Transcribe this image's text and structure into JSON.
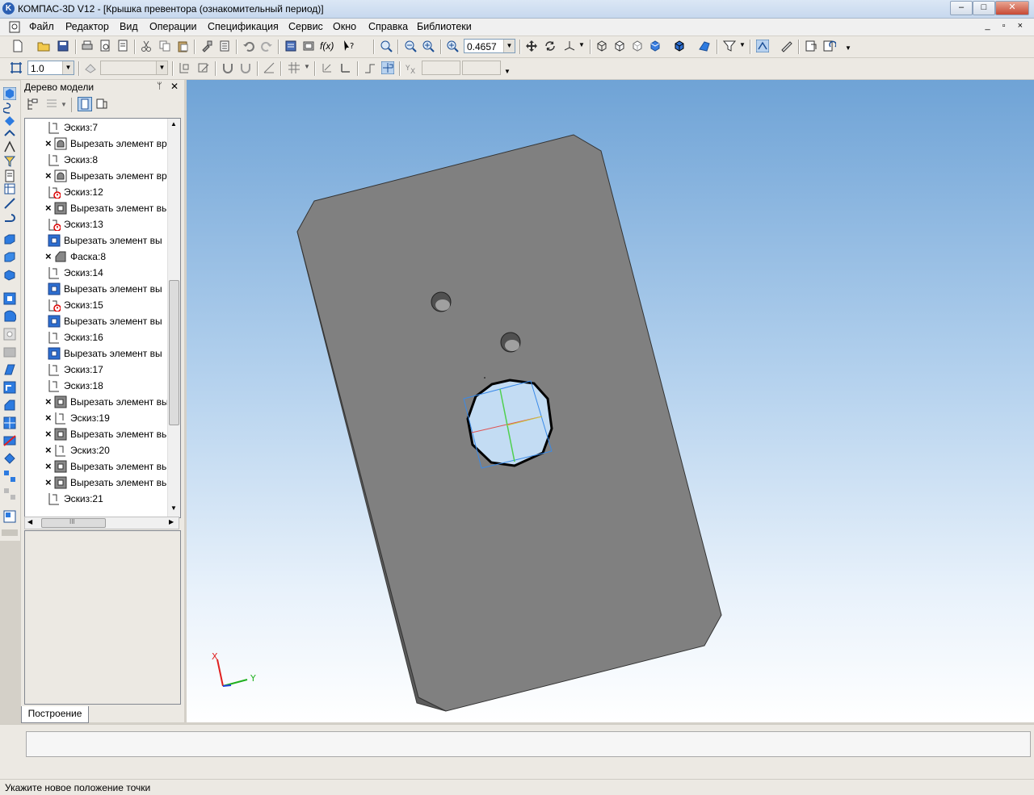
{
  "window": {
    "title": "КОМПАС-3D V12 - [Крышка превентора (ознакомительный период)]",
    "logo_letter": "K",
    "buttons": [
      "–",
      "□",
      "✕"
    ]
  },
  "menu": [
    {
      "label": "Файл"
    },
    {
      "label": "Редактор"
    },
    {
      "label": "Вид"
    },
    {
      "label": "Операции"
    },
    {
      "label": "Спецификация"
    },
    {
      "label": "Сервис"
    },
    {
      "label": "Окно"
    },
    {
      "label": "Справка"
    },
    {
      "label": "Библиотеки"
    }
  ],
  "mdi_buttons": "_ ▫ ×",
  "toolbar_main": {
    "fx_label": "f(x)",
    "zoom_value": "0.4657"
  },
  "toolbar_second": {
    "scale_value": "1.0"
  },
  "tree": {
    "title": "Дерево модели",
    "pin_glyph": "ᛘ",
    "close_glyph": "✕",
    "rows": [
      {
        "label": "Эскиз:7",
        "icon": "sketch-icon",
        "x": false,
        "err": false
      },
      {
        "label": "Вырезать элемент вр",
        "icon": "cut-rotate-icon",
        "x": true,
        "err": false
      },
      {
        "label": "Эскиз:8",
        "icon": "sketch-icon",
        "x": false,
        "err": false
      },
      {
        "label": "Вырезать элемент вр",
        "icon": "cut-rotate-icon",
        "x": true,
        "err": false
      },
      {
        "label": "Эскиз:12",
        "icon": "sketch-icon",
        "x": false,
        "err": true
      },
      {
        "label": "Вырезать элемент вь",
        "icon": "cut-extrude-icon",
        "x": true,
        "err": false
      },
      {
        "label": "Эскиз:13",
        "icon": "sketch-icon",
        "x": false,
        "err": true
      },
      {
        "label": "Вырезать элемент вы",
        "icon": "cut-extrude-blue-icon",
        "x": false,
        "err": false
      },
      {
        "label": "Фаска:8",
        "icon": "chamfer-icon",
        "x": true,
        "err": false
      },
      {
        "label": "Эскиз:14",
        "icon": "sketch-icon",
        "x": false,
        "err": false
      },
      {
        "label": "Вырезать элемент вы",
        "icon": "cut-extrude-blue-icon",
        "x": false,
        "err": false
      },
      {
        "label": "Эскиз:15",
        "icon": "sketch-icon",
        "x": false,
        "err": true
      },
      {
        "label": "Вырезать элемент вы",
        "icon": "cut-extrude-blue-icon",
        "x": false,
        "err": false
      },
      {
        "label": "Эскиз:16",
        "icon": "sketch-icon",
        "x": false,
        "err": false
      },
      {
        "label": "Вырезать элемент вы",
        "icon": "cut-extrude-blue-icon",
        "x": false,
        "err": false
      },
      {
        "label": "Эскиз:17",
        "icon": "sketch-icon",
        "x": false,
        "err": false
      },
      {
        "label": "Эскиз:18",
        "icon": "sketch-icon",
        "x": false,
        "err": false
      },
      {
        "label": "Вырезать элемент вы",
        "icon": "cut-extrude-icon",
        "x": true,
        "err": false
      },
      {
        "label": "Эскиз:19",
        "icon": "sketch-icon",
        "x": true,
        "err": false
      },
      {
        "label": "Вырезать элемент вь",
        "icon": "cut-extrude-icon",
        "x": true,
        "err": false
      },
      {
        "label": "Эскиз:20",
        "icon": "sketch-icon",
        "x": true,
        "err": false
      },
      {
        "label": "Вырезать элемент вь",
        "icon": "cut-extrude-icon",
        "x": true,
        "err": false
      },
      {
        "label": "Вырезать элемент вь",
        "icon": "cut-extrude-icon",
        "x": true,
        "err": false
      },
      {
        "label": "Эскиз:21",
        "icon": "sketch-icon",
        "x": false,
        "err": false
      }
    ],
    "tab_label": "Построение",
    "hscroll_glyph": "III"
  },
  "viewport": {
    "axis_x_label": "X",
    "axis_y_label": "Y",
    "colors": {
      "plate": "#808080",
      "plate_edge": "#5a5a5a",
      "axis_x": "#e02020",
      "axis_y": "#20b020",
      "axis_z": "#2040e0"
    }
  },
  "status": {
    "text": "Укажите новое положение точки"
  }
}
